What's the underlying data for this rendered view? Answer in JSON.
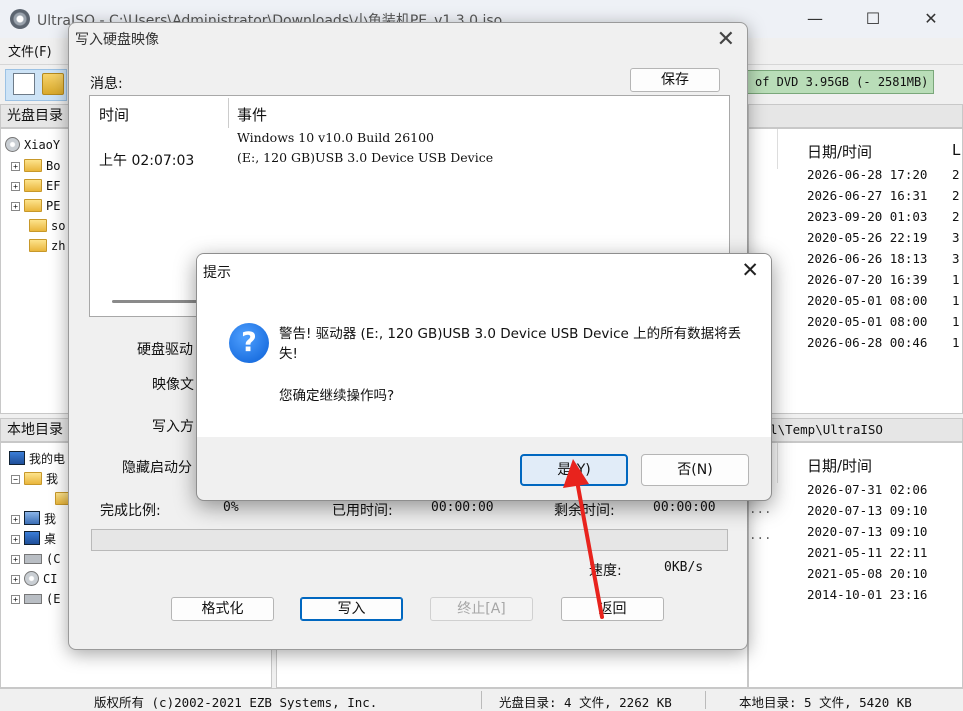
{
  "window": {
    "title": "UltraISO - C:\\Users\\Administrator\\Downloads\\小鱼装机PE_v1.3.0.iso",
    "minimize": "—",
    "maximize": "☐",
    "close": "✕"
  },
  "menu": {
    "file": "文件(F)"
  },
  "toolbar": {
    "capacity": "of DVD 3.95GB (- 2581MB)"
  },
  "cd_panel": {
    "header": "光盘目录",
    "tree": [
      {
        "label": "XiaoY"
      },
      {
        "label": "Bo"
      },
      {
        "label": "EF"
      },
      {
        "label": "PE"
      },
      {
        "label": "so"
      },
      {
        "label": "zh"
      }
    ],
    "col_date": "日期/时间",
    "col_l": "L",
    "dates": [
      {
        "date": "2026-06-28 17:20",
        "l": "2"
      },
      {
        "date": "2026-06-27 16:31",
        "l": "2"
      },
      {
        "date": "2023-09-20 01:03",
        "l": "2"
      },
      {
        "date": "2020-05-26 22:19",
        "l": "3"
      },
      {
        "date": "2026-06-26 18:13",
        "l": "3"
      },
      {
        "date": "2026-07-20 16:39",
        "l": "1"
      },
      {
        "date": "2020-05-01 08:00",
        "l": "1"
      },
      {
        "date": "2020-05-01 08:00",
        "l": "1"
      },
      {
        "date": "2026-06-28 00:46",
        "l": "1"
      }
    ]
  },
  "local_panel": {
    "header": "本地目录",
    "path": "cal\\Temp\\UltraISO",
    "tree": [
      {
        "label": "我的电"
      },
      {
        "label": "我"
      },
      {
        "label": ""
      },
      {
        "label": "我"
      },
      {
        "label": "桌"
      },
      {
        "label": "(C"
      },
      {
        "label": "CI"
      },
      {
        "label": "(E"
      }
    ],
    "col_date": "日期/时间",
    "dots": "...",
    "dates": [
      "2026-07-31 02:06",
      "2020-07-13 09:10",
      "2020-07-13 09:10",
      "2021-05-11 22:11",
      "2021-05-08 20:10",
      "2014-10-01 23:16"
    ]
  },
  "statusbar": {
    "copyright": "版权所有 (c)2002-2021 EZB Systems, Inc.",
    "cd_dir": "光盘目录: 4 文件, 2262 KB",
    "local_dir": "本地目录: 5 文件, 5420 KB"
  },
  "write_dialog": {
    "title": "写入硬盘映像",
    "close": "✕",
    "message_label": "消息:",
    "save": "保存",
    "log_header_time": "时间",
    "log_header_event": "事件",
    "log_time": "上午 02:07:03",
    "log_line1": "Windows 10 v10.0 Build 26100",
    "log_line2": "(E:, 120 GB)USB 3.0 Device USB Device",
    "label_drive": "硬盘驱动",
    "label_image": "映像文",
    "label_method": "写入方",
    "label_hide": "隐藏启动分",
    "progress_label": "完成比例:",
    "progress_value": "0%",
    "progress_fraction": 0,
    "elapsed_label": "已用时间:",
    "elapsed_value": "00:00:00",
    "remaining_label": "剩余时间:",
    "remaining_value": "00:00:00",
    "speed_label": "速度:",
    "speed_value": "0KB/s",
    "btn_format": "格式化",
    "btn_write": "写入",
    "btn_abort": "终止[A]",
    "btn_back": "返回"
  },
  "confirm_dialog": {
    "title": "提示",
    "close": "✕",
    "icon": "?",
    "warning": "警告! 驱动器 (E:, 120 GB)USB 3.0 Device USB Device 上的所有数据将丢失!",
    "question": "您确定继续操作吗?",
    "yes": "是(Y)",
    "no": "否(N)"
  },
  "annotation": {
    "color": "#e8231d"
  }
}
